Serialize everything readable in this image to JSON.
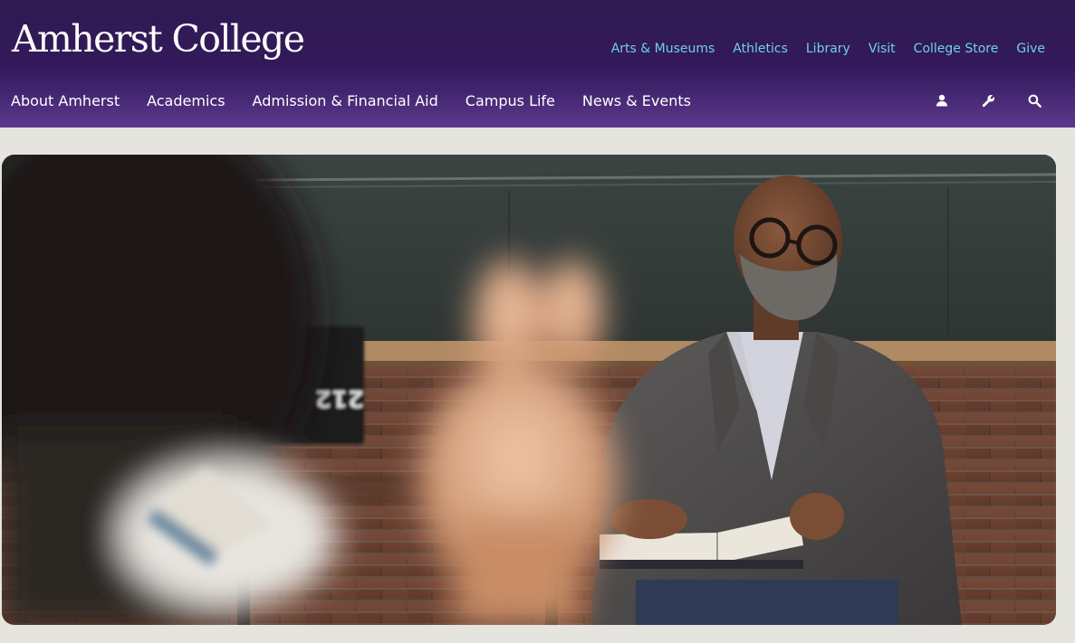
{
  "site": {
    "logo_text": "Amherst College"
  },
  "utility_nav": [
    {
      "label": "Arts & Museums"
    },
    {
      "label": "Athletics"
    },
    {
      "label": "Library"
    },
    {
      "label": "Visit"
    },
    {
      "label": "College Store"
    },
    {
      "label": "Give"
    }
  ],
  "main_nav": [
    {
      "label": "About Amherst"
    },
    {
      "label": "Academics"
    },
    {
      "label": "Admission & Financial Aid"
    },
    {
      "label": "Campus Life"
    },
    {
      "label": "News & Events"
    }
  ],
  "tools": {
    "icons": [
      "user-icon",
      "wrench-icon",
      "search-icon"
    ]
  },
  "hero": {
    "image_subject": "Professor seated in a classroom holding an open book, student with raised hand in foreground",
    "room_number": "212"
  },
  "colors": {
    "header_purple": "#33195a",
    "utility_link": "#6fd0e8",
    "page_background": "#e6e4df"
  }
}
